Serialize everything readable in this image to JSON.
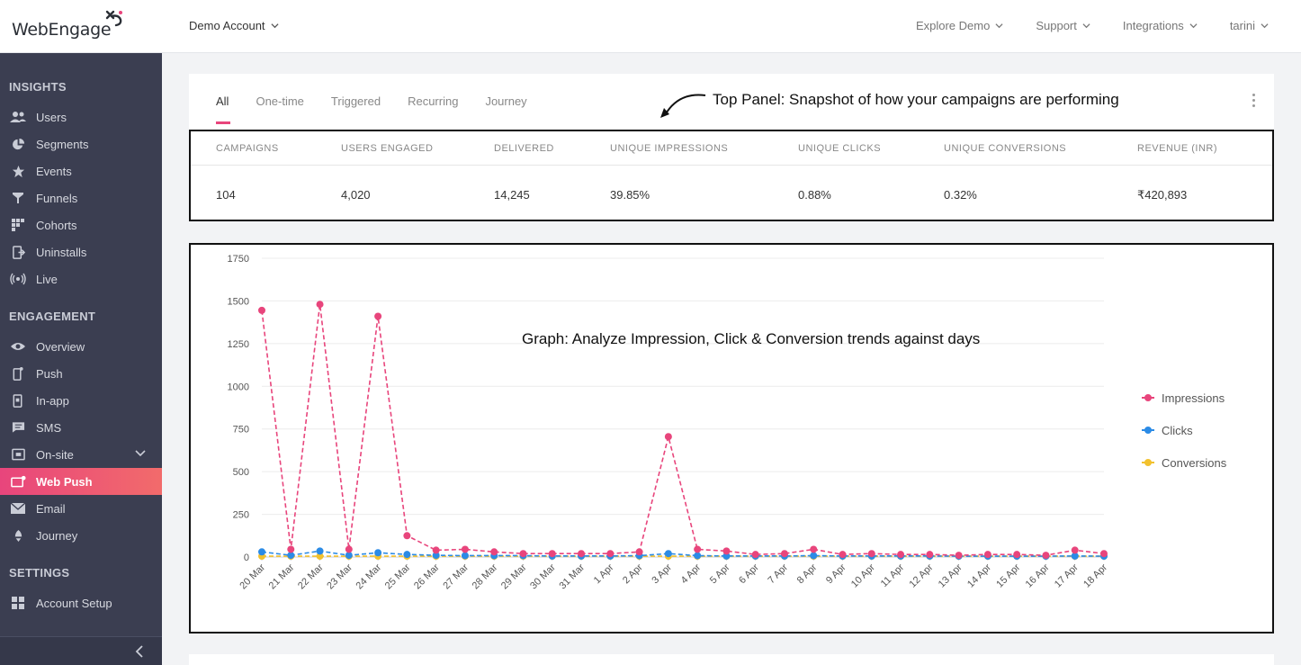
{
  "header": {
    "logo_text": "WebEngage",
    "account_label": "Demo Account",
    "nav": [
      {
        "label": "Explore Demo"
      },
      {
        "label": "Support"
      },
      {
        "label": "Integrations"
      },
      {
        "label": "tarini"
      }
    ]
  },
  "sidebar": {
    "sections": [
      {
        "title": "INSIGHTS",
        "items": [
          {
            "label": "Users",
            "icon": "users-icon"
          },
          {
            "label": "Segments",
            "icon": "pie-chart-icon"
          },
          {
            "label": "Events",
            "icon": "star-icon"
          },
          {
            "label": "Funnels",
            "icon": "funnel-icon"
          },
          {
            "label": "Cohorts",
            "icon": "grid-icon"
          },
          {
            "label": "Uninstalls",
            "icon": "uninstall-icon"
          },
          {
            "label": "Live",
            "icon": "broadcast-icon"
          }
        ]
      },
      {
        "title": "ENGAGEMENT",
        "items": [
          {
            "label": "Overview",
            "icon": "eye-icon"
          },
          {
            "label": "Push",
            "icon": "mobile-icon"
          },
          {
            "label": "In-app",
            "icon": "in-app-icon"
          },
          {
            "label": "SMS",
            "icon": "chat-icon"
          },
          {
            "label": "On-site",
            "icon": "window-icon"
          },
          {
            "label": "Web Push",
            "icon": "web-push-icon",
            "active": true
          },
          {
            "label": "Email",
            "icon": "mail-icon"
          },
          {
            "label": "Journey",
            "icon": "journey-icon"
          }
        ]
      },
      {
        "title": "SETTINGS",
        "items": [
          {
            "label": "Account Setup",
            "icon": "setup-icon"
          }
        ]
      }
    ]
  },
  "tabs": [
    "All",
    "One-time",
    "Triggered",
    "Recurring",
    "Journey"
  ],
  "active_tab": "All",
  "annotations": {
    "top_panel": "Top Panel: Snapshot of how your campaigns are performing",
    "graph": "Graph: Analyze Impression, Click & Conversion trends against days"
  },
  "stats": [
    {
      "label": "CAMPAIGNS",
      "value": "104"
    },
    {
      "label": "USERS ENGAGED",
      "value": "4,020"
    },
    {
      "label": "DELIVERED",
      "value": "14,245"
    },
    {
      "label": "UNIQUE IMPRESSIONS",
      "value": "39.85%"
    },
    {
      "label": "UNIQUE CLICKS",
      "value": "0.88%"
    },
    {
      "label": "UNIQUE CONVERSIONS",
      "value": "0.32%"
    },
    {
      "label": "REVENUE (INR)",
      "value": "₹420,893"
    }
  ],
  "colors": {
    "accent": "#e8457c",
    "impressions": "#e8457c",
    "clicks": "#2b8be6",
    "conversions": "#f2c12e",
    "sidebar_bg": "#3b3e51"
  },
  "chart_data": {
    "type": "line",
    "x": [
      "20 Mar",
      "21 Mar",
      "22 Mar",
      "23 Mar",
      "24 Mar",
      "25 Mar",
      "26 Mar",
      "27 Mar",
      "28 Mar",
      "29 Mar",
      "30 Mar",
      "31 Mar",
      "1 Apr",
      "2 Apr",
      "3 Apr",
      "4 Apr",
      "5 Apr",
      "6 Apr",
      "7 Apr",
      "8 Apr",
      "9 Apr",
      "10 Apr",
      "11 Apr",
      "12 Apr",
      "13 Apr",
      "14 Apr",
      "15 Apr",
      "16 Apr",
      "17 Apr",
      "18 Apr"
    ],
    "y_ticks": [
      "0",
      "250",
      "500",
      "750",
      "1000",
      "1250",
      "1500",
      "1750"
    ],
    "ylim": [
      0,
      1750
    ],
    "series": [
      {
        "name": "Impressions",
        "color": "#e8457c",
        "values": [
          1445,
          45,
          1480,
          45,
          1410,
          125,
          40,
          45,
          30,
          20,
          20,
          20,
          20,
          30,
          705,
          45,
          35,
          15,
          20,
          45,
          15,
          20,
          15,
          15,
          10,
          15,
          15,
          10,
          40,
          20
        ]
      },
      {
        "name": "Clicks",
        "color": "#2b8be6",
        "values": [
          30,
          10,
          35,
          10,
          25,
          15,
          10,
          8,
          8,
          8,
          6,
          6,
          6,
          8,
          20,
          8,
          6,
          6,
          6,
          8,
          6,
          6,
          6,
          6,
          5,
          5,
          5,
          5,
          6,
          5
        ]
      },
      {
        "name": "Conversions",
        "color": "#f2c12e",
        "values": [
          5,
          5,
          5,
          5,
          5,
          5,
          5,
          5,
          5,
          5,
          5,
          5,
          5,
          5,
          5,
          5,
          5,
          5,
          5,
          5,
          5,
          5,
          5,
          5,
          5,
          5,
          5,
          5,
          5,
          5
        ]
      }
    ],
    "legend": "right",
    "grid": true
  }
}
